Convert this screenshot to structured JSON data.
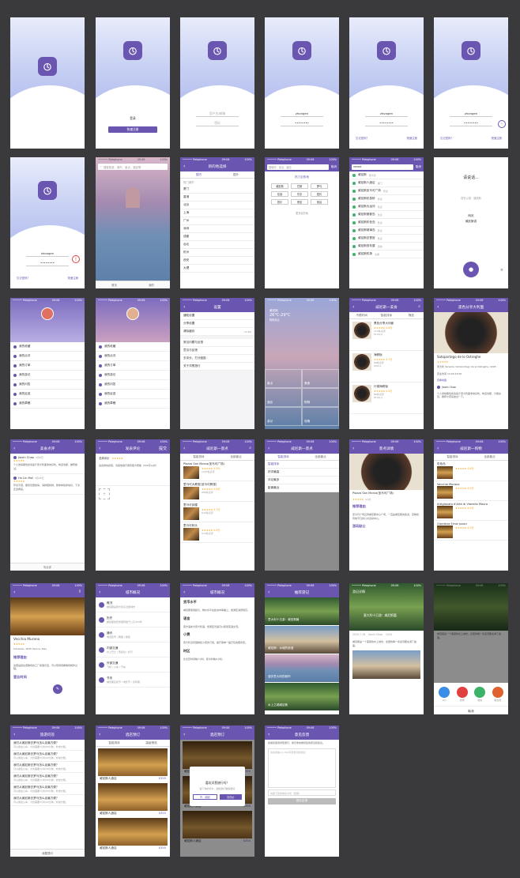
{
  "status": {
    "carrier": "•••••• Pelephone",
    "time": "09:06",
    "battery": "100%"
  },
  "splash": {
    "brand": "洋葱旅行",
    "slogan": "随时随地发现世界"
  },
  "login": {
    "user_placeholder": "用户名/邮箱",
    "pass_placeholder": "密码",
    "user_value": "zhongen",
    "pass_value": "••••••••",
    "login_btn": "登录",
    "quick_register": "快速注册",
    "login_btn2": "登录",
    "forgot": "忘记密码？",
    "register": "快速注册"
  },
  "search": {
    "placeholder": "搜索旅游、城市、景点、酒店等",
    "hot_placeholder": "搜城市、景点、酒店",
    "cancel": "取消",
    "hot_label": "热门目的地",
    "hot_tags": [
      "威尼斯",
      "巴黎",
      "罗马",
      "伦敦",
      "东京",
      "纽约",
      "首尔",
      "悉尼",
      "曼谷"
    ],
    "hot_more": "更多目的地",
    "query": "venezi"
  },
  "home": {
    "tab_home": "首页",
    "tab_me": "我的"
  },
  "city_picker": {
    "title": "目的地选择",
    "tab_domestic": "国内",
    "tab_abroad": "国外",
    "hot": "热门城市",
    "list": [
      "厦门",
      "香港",
      "北京",
      "上海",
      "广州",
      "深圳",
      "成都",
      "台北",
      "杭州",
      "西安",
      "大理"
    ]
  },
  "suggest": {
    "items": [
      {
        "name": "威尼斯",
        "sub": "意大利"
      },
      {
        "name": "威尼斯人酒店",
        "sub": "澳门"
      },
      {
        "name": "威尼斯圣马可广场",
        "sub": "景点"
      },
      {
        "name": "威尼斯叹息桥",
        "sub": "景点"
      },
      {
        "name": "威尼斯大运河",
        "sub": "景点"
      },
      {
        "name": "威尼斯丽都岛",
        "sub": "景点"
      },
      {
        "name": "威尼斯彩色岛",
        "sub": "景点"
      },
      {
        "name": "威尼斯玻璃岛",
        "sub": "景点"
      },
      {
        "name": "威尼斯总督宫",
        "sub": "景点"
      },
      {
        "name": "威尼斯双年展",
        "sub": "活动"
      },
      {
        "name": "威尼斯机场",
        "sub": "交通"
      }
    ]
  },
  "voice": {
    "prompt": "请说话...",
    "hint": "您可以说：威尼斯",
    "example1": "网页",
    "example2": "威尼斯游",
    "cancel": "取消"
  },
  "profile": {
    "menu1": [
      "我的收藏",
      "我的点评",
      "我的订单",
      "我的游记",
      "我的问答",
      "我的足迹",
      "我的草稿"
    ],
    "menu2": [
      "我的收藏",
      "我的点评",
      "我的订单",
      "我的游记",
      "我的问答",
      "我的足迹",
      "我的草稿"
    ]
  },
  "settings": {
    "title": "设置",
    "items": [
      "通知设置",
      "分享设置",
      "清除缓存",
      "常见问题与反馈",
      "意见与反馈",
      "去评分，打分鼓励",
      "关于洋葱旅行"
    ],
    "cache": "23.6M"
  },
  "weather": {
    "city": "威尼斯",
    "temp": "26°C-29°C",
    "desc": "晴转多云",
    "cards": [
      "景点",
      "美食",
      "酒店",
      "购物",
      "游记",
      "攻略"
    ]
  },
  "list": {
    "title": "威尼斯一美食",
    "filter1": "不限时间",
    "filter2": "智能排序",
    "filter3": "筛选",
    "items": [
      {
        "name": "黑色分享大利面",
        "score": "4.8分",
        "reviews": "124条点评",
        "price": "¥120/人"
      },
      {
        "name": "海鲜饭",
        "score": "4.7分",
        "reviews": "98条点评",
        "price": "¥90/人"
      },
      {
        "name": "什锦海鲜饭",
        "score": "4.6分",
        "reviews": "86条点评",
        "price": "¥100/人"
      }
    ]
  },
  "detail": {
    "title": "黑色分享大利面",
    "name": "Sotoportego de le Ostreghe",
    "address": "意大利 Venezia, Sotoportego de le Ostreghe, 2295",
    "hours": "营业时间 12:00-23:00",
    "tag": "查看地图",
    "reviewer": "Jiaxin Chao",
    "review": "个人觉得黑色的墨鱼汁意大利面非常好吃，味道浓郁，分量充足，推荐大家来尝试一下。"
  },
  "reviews": {
    "title": "美食点评",
    "write": "写点评",
    "items": [
      {
        "user": "Jiaxin Chao",
        "date": "5月8日",
        "text": "个人觉得黑色的墨鱼汁意大利面非常好吃，味道浓郁，推荐尝试。"
      },
      {
        "user": "Hu Lin Mei",
        "date": "4月28日",
        "text": "环境不错，服务员很热情，海鲜很新鲜，整体体验非常好，下次还会再来。"
      }
    ]
  },
  "write_review": {
    "title": "发表评论",
    "score": "总体评价",
    "placeholder": "说说你的感受，对其他旅行者有很大帮助（200字以内）",
    "submit": "提交"
  },
  "sights": {
    "title": "威尼斯一景点",
    "filter1": "智能排序",
    "filter2": "全部景点",
    "items": [
      {
        "name": "Piazza San Marco(圣马可广场)",
        "score": "4.9分",
        "reviews": "1325条点评"
      },
      {
        "name": "里马可大教堂(圣马可教堂)",
        "score": "4.8分",
        "reviews": "986条点评"
      },
      {
        "name": "里马可钟楼",
        "score": "4.7分",
        "reviews": "642条点评"
      },
      {
        "name": "里马可码头",
        "score": "4.6分",
        "reviews": "520条点评"
      }
    ],
    "sort_options": [
      "智能排序",
      "好评最高",
      "评论最多",
      "距离最近"
    ]
  },
  "sight_detail": {
    "title": "景点详情",
    "name": "Piazza San Marco(圣马可广场)",
    "score": "4.9分",
    "desc": "圣马可广场又称威尼斯中心广场，一直是威尼斯的政治、宗教和传统节日的公共活动中心。",
    "recommend": "推荐理由",
    "tips": "游玩贴士"
  },
  "shop": {
    "title": "威尼斯一购物",
    "items": [
      {
        "name": "彩色岛",
        "score": "4.6分"
      },
      {
        "name": "Vecchia Murano",
        "score": "4.5分"
      },
      {
        "name": "Artigianato d'Arte di Vianello Mauro",
        "score": "4.4分"
      },
      {
        "name": "Giordena Ernie Juvan",
        "score": "4.3分"
      }
    ]
  },
  "shop_detail": {
    "name": "Vecchia Murano",
    "address": "Canareio, 1635 Venice, Italy",
    "recommend": "推荐理由",
    "desc": "这里是穆拉诺玻璃的工厂和展示店，可以现场观看玻璃制作过程。",
    "tips": "营业时间"
  },
  "overview": {
    "title": "城市概况",
    "items": [
      {
        "name": "概况",
        "sub": "威尼斯是意大利东北部城市"
      },
      {
        "name": "历史",
        "sub": "威尼斯的历史相传始于公元453年"
      },
      {
        "name": "通讯",
        "sub": "电话区号 / 网络 / 邮政"
      },
      {
        "name": "内部交通",
        "sub": "水上巴士 / 贡多拉 / 步行"
      },
      {
        "name": "外部交通",
        "sub": "飞机 / 火车 / 汽车"
      },
      {
        "name": "节庆",
        "sub": "威尼斯狂欢节 / 电影节 / 双年展"
      }
    ]
  },
  "overview_detail": {
    "title": "城市概况",
    "sections": [
      {
        "head": "货币水平",
        "body": "威尼斯使用欧元，物价水平在欧洲中等偏上，旅游区消费较高。"
      },
      {
        "head": "语言",
        "body": "官方语言为意大利语，旅游区普遍可以使用英语交流。"
      },
      {
        "head": "小费",
        "body": "意大利没有强制给小费的习惯，餐厅账单一般已包含服务费。"
      },
      {
        "head": "时区",
        "body": "比北京时间晚7小时，夏令时晚6小时。"
      }
    ]
  },
  "guides": {
    "title": "推荐游记",
    "items": [
      "意大利十日游：威尼斯篇",
      "威尼斯：水城的浪漫",
      "漫步意大利的城市",
      "水上之城威尼斯"
    ]
  },
  "guide_detail": {
    "title": "游记详情",
    "headline": "意大利十日游：威尼斯篇",
    "author": "Jiaxin Chao",
    "date": "2015.7.18",
    "views": "1234",
    "body": "威尼斯是一个美丽的水上城市，这里的每一条运河都充满了故事。"
  },
  "share": {
    "title": "分享到",
    "items": [
      "QQ",
      "微博",
      "微信",
      "朋友圈"
    ],
    "cancel": "取消"
  },
  "qa": {
    "title": "旅游问答",
    "q": "我们从威尼斯去罗马怎么走最方便？",
    "a": "可以乘坐火车，大约需要3小时45分钟，非常方便。",
    "ask": "我要提问"
  },
  "hotels": {
    "title": "酒店预订",
    "filter1": "智能排序",
    "filter2": "高级筛选",
    "items": [
      {
        "name": "威尼斯人酒店",
        "price": "$350"
      },
      {
        "name": "威尼斯人酒店",
        "price": "$350"
      },
      {
        "name": "威尼斯人酒店",
        "price": "$350"
      }
    ]
  },
  "rate_popup": {
    "title": "喜欢洋葱旅行吗？",
    "body": "留下你的评价，鼓励我们做得更好",
    "no": "不，谢谢",
    "yes": "去评价"
  },
  "feedback": {
    "title": "意见反馈",
    "intro": "感谢您使用洋葱旅行，我们非常重视您的意见和建议。",
    "placeholder": "请在此输入1-500字的意见和建议",
    "contact": "请留下您的联系方式（选填）",
    "submit": "提交反馈"
  }
}
